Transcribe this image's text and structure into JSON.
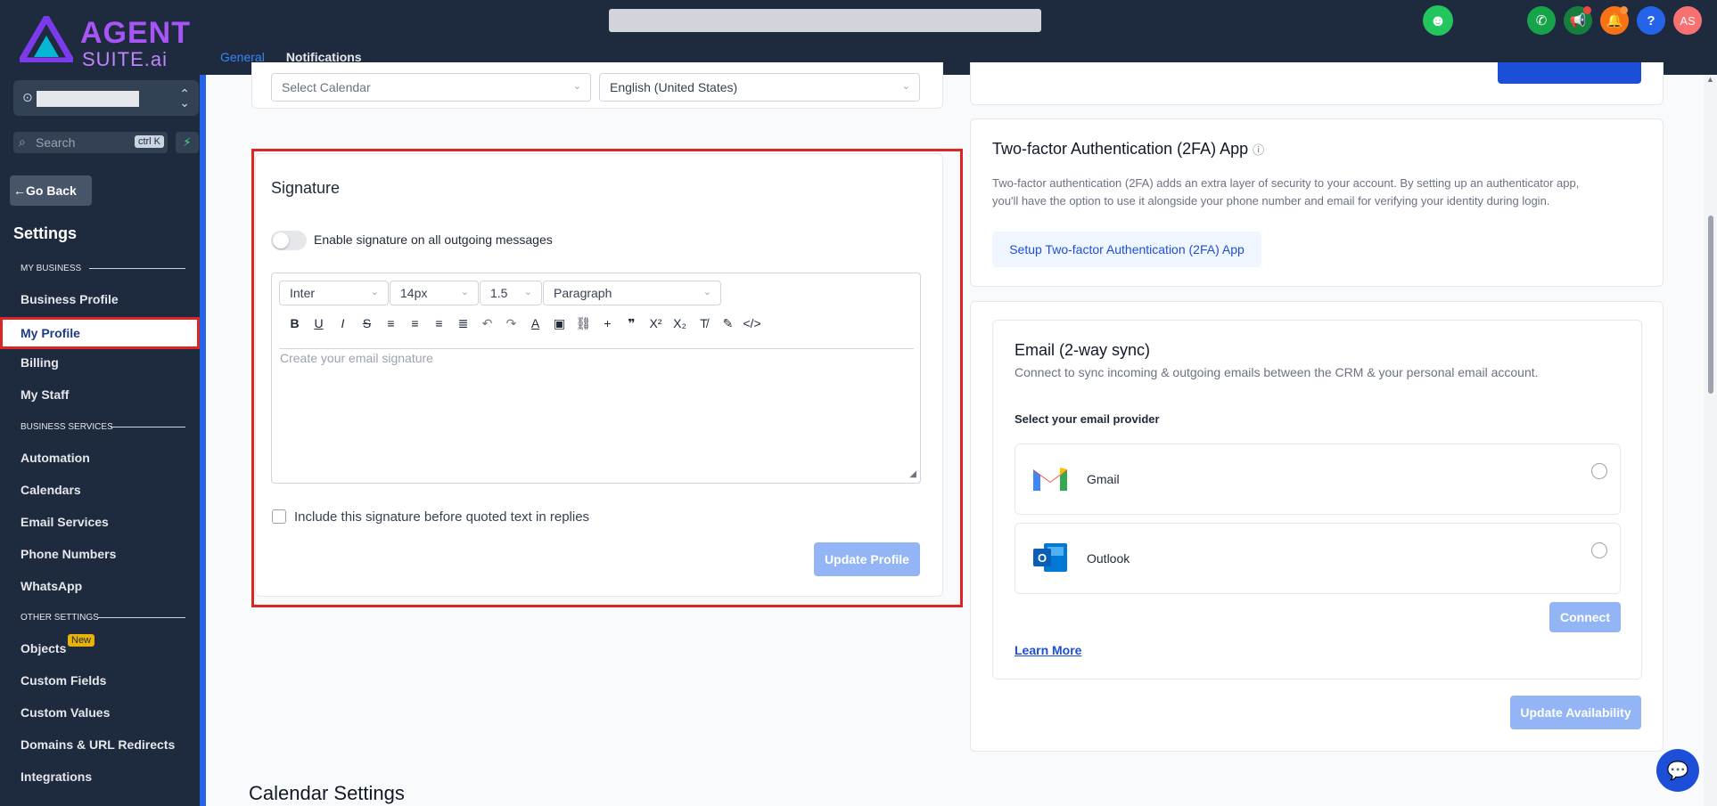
{
  "brand": {
    "line1": "AGENT",
    "line2": "SUITE.ai"
  },
  "top_tabs": [
    {
      "label": "General",
      "active": true
    },
    {
      "label": "Notifications",
      "active": false
    }
  ],
  "header": {
    "avatar_initials": "AS",
    "help_label": "?"
  },
  "sidebar": {
    "search_placeholder": "Search",
    "search_shortcut": "ctrl K",
    "go_back": "Go Back",
    "title": "Settings",
    "sections": {
      "my_business": "MY BUSINESS",
      "business_services": "BUSINESS SERVICES",
      "other_settings": "OTHER SETTINGS"
    },
    "items": {
      "business_profile": "Business Profile",
      "my_profile": "My Profile",
      "billing": "Billing",
      "my_staff": "My Staff",
      "automation": "Automation",
      "calendars": "Calendars",
      "email_services": "Email Services",
      "phone_numbers": "Phone Numbers",
      "whatsapp": "WhatsApp",
      "objects": "Objects",
      "objects_badge": "New",
      "custom_fields": "Custom Fields",
      "custom_values": "Custom Values",
      "domains": "Domains & URL Redirects",
      "integrations": "Integrations"
    }
  },
  "profile": {
    "calendar_select": "Select Calendar",
    "language_select": "English (United States)"
  },
  "signature": {
    "title": "Signature",
    "enable_label": "Enable signature on all outgoing messages",
    "font": "Inter",
    "size": "14px",
    "line_height": "1.5",
    "block": "Paragraph",
    "placeholder": "Create your email signature",
    "include_label": "Include this signature before quoted text in replies",
    "update_button": "Update Profile"
  },
  "twofa": {
    "title": "Two-factor Authentication (2FA) App",
    "desc_line1": "Two-factor authentication (2FA) adds an extra layer of security to your account. By setting up an authenticator app,",
    "desc_line2": "you'll have the option to use it alongside your phone number and email for verifying your identity during login.",
    "setup_button": "Setup Two-factor Authentication (2FA) App"
  },
  "email_sync": {
    "title": "Email (2-way sync)",
    "desc": "Connect to sync incoming & outgoing emails between the CRM & your personal email account.",
    "provider_label": "Select your email provider",
    "providers": [
      "Gmail",
      "Outlook"
    ],
    "connect_button": "Connect",
    "learn_more": "Learn More",
    "update_availability": "Update Availability"
  },
  "calendar_settings": {
    "title": "Calendar Settings"
  },
  "colors": {
    "sidebar_bg": "#1e2a3e",
    "accent": "#3b82f6",
    "highlight": "#dc2626",
    "brand": "#a855f7"
  }
}
